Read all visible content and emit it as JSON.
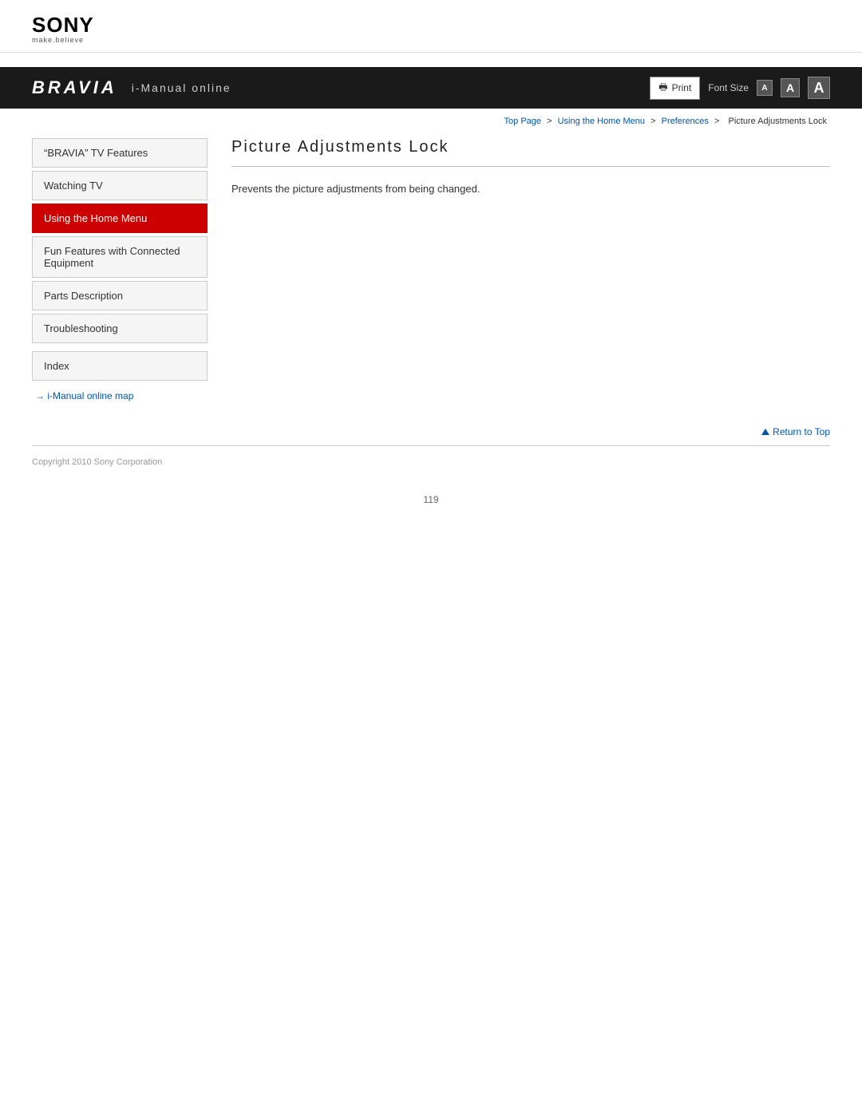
{
  "logo": {
    "brand": "SONY",
    "tagline": "make.believe"
  },
  "header": {
    "bravia": "BRAVIA",
    "imanual": "i-Manual online",
    "print_label": "Print",
    "font_size_label": "Font Size",
    "font_sm": "A",
    "font_md": "A",
    "font_lg": "A"
  },
  "breadcrumb": {
    "top_page": "Top Page",
    "sep1": ">",
    "home_menu": "Using the Home Menu",
    "sep2": ">",
    "preferences": "Preferences",
    "sep3": ">",
    "current": "Picture Adjustments Lock"
  },
  "sidebar": {
    "items": [
      {
        "id": "bravia-features",
        "label": "“BRAVIA” TV Features",
        "active": false
      },
      {
        "id": "watching-tv",
        "label": "Watching TV",
        "active": false
      },
      {
        "id": "using-home-menu",
        "label": "Using the Home Menu",
        "active": true
      },
      {
        "id": "fun-features",
        "label": "Fun Features with Connected Equipment",
        "active": false
      },
      {
        "id": "parts-description",
        "label": "Parts Description",
        "active": false
      },
      {
        "id": "troubleshooting",
        "label": "Troubleshooting",
        "active": false
      }
    ],
    "index_label": "Index",
    "map_link_label": "→ i-Manual online map"
  },
  "content": {
    "page_title": "Picture Adjustments Lock",
    "description": "Prevents the picture adjustments from being changed."
  },
  "return_top": {
    "label": "Return to Top"
  },
  "footer": {
    "copyright": "Copyright 2010 Sony Corporation",
    "page_number": "119"
  }
}
